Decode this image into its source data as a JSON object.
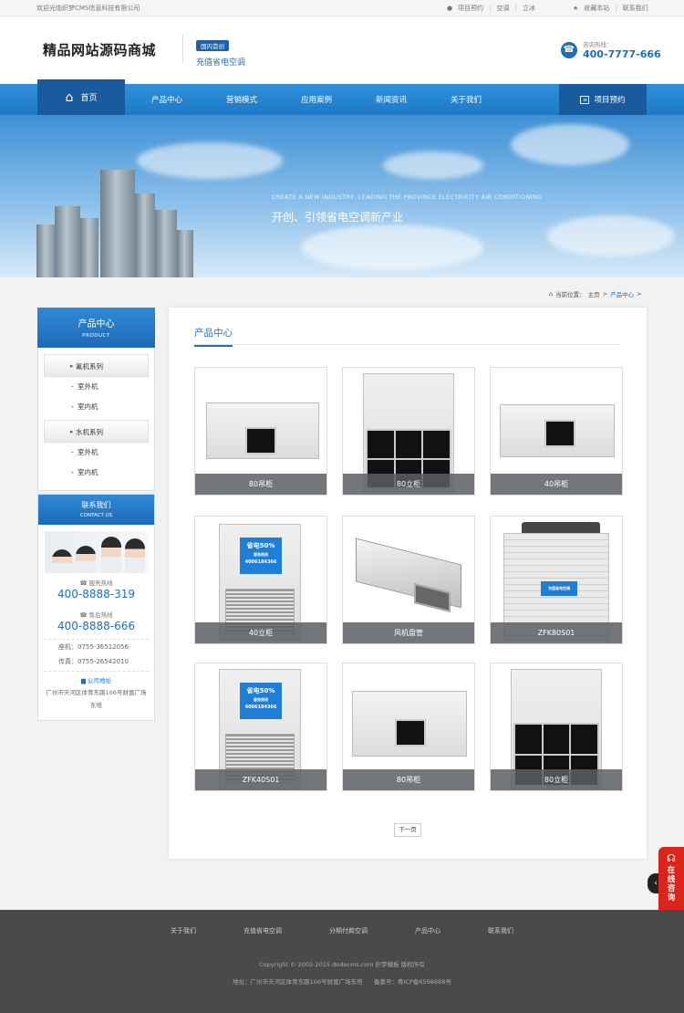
{
  "topbar": {
    "welcome": "欢迎光临织梦CMS信息科技有限公司",
    "links": [
      "项目预约",
      "空调",
      "立冰"
    ],
    "fav": "收藏本站",
    "contact": "联系我们"
  },
  "header": {
    "logo": "精品网站源码商城",
    "badge": "国内首创",
    "slogan": "充值省电空调",
    "hotline_label": "咨询热线：",
    "hotline": "400-7777-666"
  },
  "nav": {
    "home": "首页",
    "items": [
      "产品中心",
      "营销模式",
      "应用案例",
      "新闻资讯",
      "关于我们"
    ],
    "book": "项目预约"
  },
  "banner": {
    "en": "CREATE A NEW INDUSTRY, LEADING THE PROVINCE ELECTRICITY AIR CONDITIONING",
    "cn": "开创、引领省电空调新产业"
  },
  "breadcrumb": {
    "label": "当前位置：",
    "home": "主页",
    "sep": ">",
    "current": "产品中心",
    "end": ">"
  },
  "sidebar": {
    "title": "产品中心",
    "subtitle": "PRODUCT",
    "categories": [
      {
        "name": "氟机系列",
        "subs": [
          "室外机",
          "室内机"
        ]
      },
      {
        "name": "水机系列",
        "subs": [
          "室外机",
          "室内机"
        ]
      }
    ]
  },
  "contact": {
    "title": "联系我们",
    "subtitle": "CONTACT US",
    "service_label": "服务热线",
    "service_num": "400-8888-319",
    "after_label": "售后热线",
    "after_num": "400-8888-666",
    "landline": "座机：0755-36512056",
    "fax": "传真：0755-26542010",
    "addr_label": "公司地址",
    "address": "广州市天河区体育东路106号财富广场东塔"
  },
  "main": {
    "title": "产品中心",
    "products": [
      {
        "name": "80吊柜",
        "kind": "ceiling"
      },
      {
        "name": "80立柜",
        "kind": "cabinet"
      },
      {
        "name": "40吊柜",
        "kind": "ceiling"
      },
      {
        "name": "40立柜",
        "kind": "sticker"
      },
      {
        "name": "风机盘管",
        "kind": "coil"
      },
      {
        "name": "ZFK80S01",
        "kind": "outdoor"
      },
      {
        "name": "ZFK40S01",
        "kind": "sticker"
      },
      {
        "name": "80吊柜",
        "kind": "ceiling"
      },
      {
        "name": "80立柜",
        "kind": "cabinet"
      }
    ],
    "sticker_big": "省电50%",
    "sticker_small": "服务热线",
    "sticker_phone": "4006184366",
    "outdoor_sticker": "充值省电空调",
    "pager_next": "下一页"
  },
  "footer": {
    "links": [
      "关于我们",
      "充值省电空调",
      "分期付款空调",
      "产品中心",
      "联系我们"
    ],
    "copyright": "Copyright © 2002-2015 dedecms.com 织梦模板 版权所有",
    "address": "地址：广州市天河区体育东路106号财富广场东塔",
    "icp": "备案号：粤ICP备6598688号"
  },
  "float": {
    "consult": "在线咨询"
  }
}
